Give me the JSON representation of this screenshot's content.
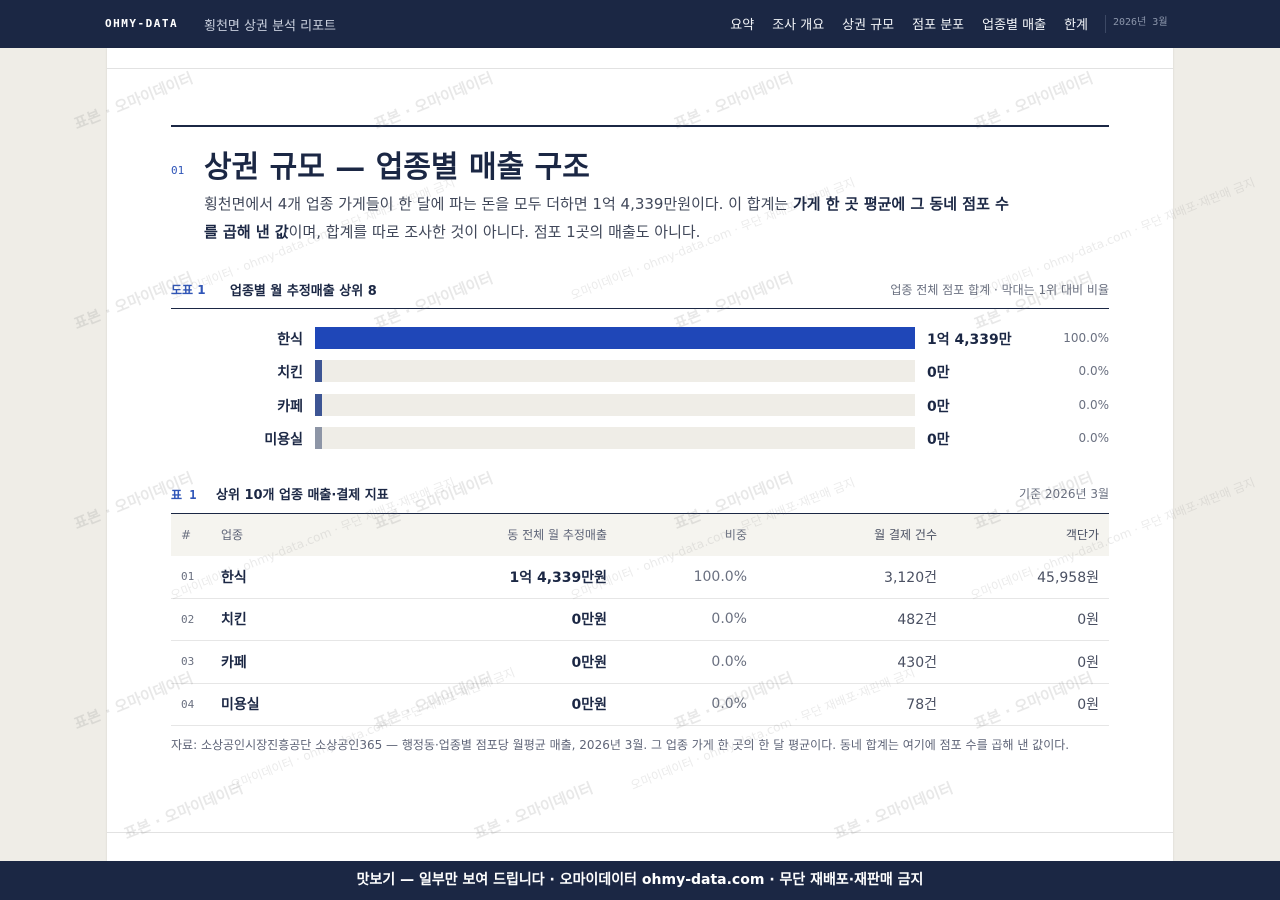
{
  "header": {
    "brand": "OHMY-DATA",
    "subtitle": "횡천면 상권 분석 리포트",
    "nav": [
      "요약",
      "조사 개요",
      "상권 규모",
      "점포 분포",
      "업종별 매출",
      "한계"
    ],
    "date": "2026년 3월"
  },
  "section": {
    "number": "01",
    "title": "상권 규모 — 업종별 매출 구조",
    "lede_part1": "횡천면에서 4개 업종 가게들이 한 달에 파는 돈을 모두 더하면 1억 4,339만원이다. 이 합계는 ",
    "lede_bold": "가게 한 곳 평균에 그 동네 점포 수를 곱해 낸 값",
    "lede_part2": "이며, 합계를 따로 조사한 것이 아니다. 점포 1곳의 매출도 아니다."
  },
  "figure": {
    "label": "도표 1",
    "title": "업종별 월 추정매출 상위 8",
    "note": "업종 전체 점포 합계 · 막대는 1위 대비 비율"
  },
  "chart_data": {
    "type": "bar",
    "categories": [
      "한식",
      "치킨",
      "카페",
      "미용실"
    ],
    "values": [
      100.0,
      0.0,
      0.0,
      0.0
    ],
    "value_labels": [
      "1억 4,339만",
      "0만",
      "0만",
      "0만"
    ],
    "pct_labels": [
      "100.0%",
      "0.0%",
      "0.0%",
      "0.0%"
    ],
    "colors": [
      "#1f47b8",
      "#3d5594",
      "#3d5594",
      "#8d95a6"
    ],
    "ylim": [
      0,
      100
    ]
  },
  "table": {
    "label": "표 1",
    "title": "상위 10개 업종 매출·결제 지표",
    "note": "기준 2026년 3월",
    "columns": [
      "#",
      "업종",
      "동 전체 월 추정매출",
      "비중",
      "월 결제 건수",
      "객단가"
    ],
    "rows": [
      {
        "num": "01",
        "name": "한식",
        "sales": "1억 4,339만원",
        "share": "100.0%",
        "count": "3,120건",
        "avg": "45,958원"
      },
      {
        "num": "02",
        "name": "치킨",
        "sales": "0만원",
        "share": "0.0%",
        "count": "482건",
        "avg": "0원"
      },
      {
        "num": "03",
        "name": "카페",
        "sales": "0만원",
        "share": "0.0%",
        "count": "430건",
        "avg": "0원"
      },
      {
        "num": "04",
        "name": "미용실",
        "sales": "0만원",
        "share": "0.0%",
        "count": "78건",
        "avg": "0원"
      }
    ]
  },
  "source": "자료: 소상공인시장진흥공단 소상공인365 — 행정동·업종별 점포당 월평균 매출, 2026년 3월. 그 업종 가게 한 곳의 한 달 평균이다. 동네 합계는 여기에 점포 수를 곱해 낸 값이다.",
  "footer": "맛보기 — 일부만 보여 드립니다 · 오마이데이터 ohmy-data.com · 무단 재배포·재판매 금지",
  "watermark": {
    "main": "표본 · 오마이데이터",
    "secondary": "오마이데이터 · ohmy-data.com · 무단 재배포·재판매 금지"
  }
}
